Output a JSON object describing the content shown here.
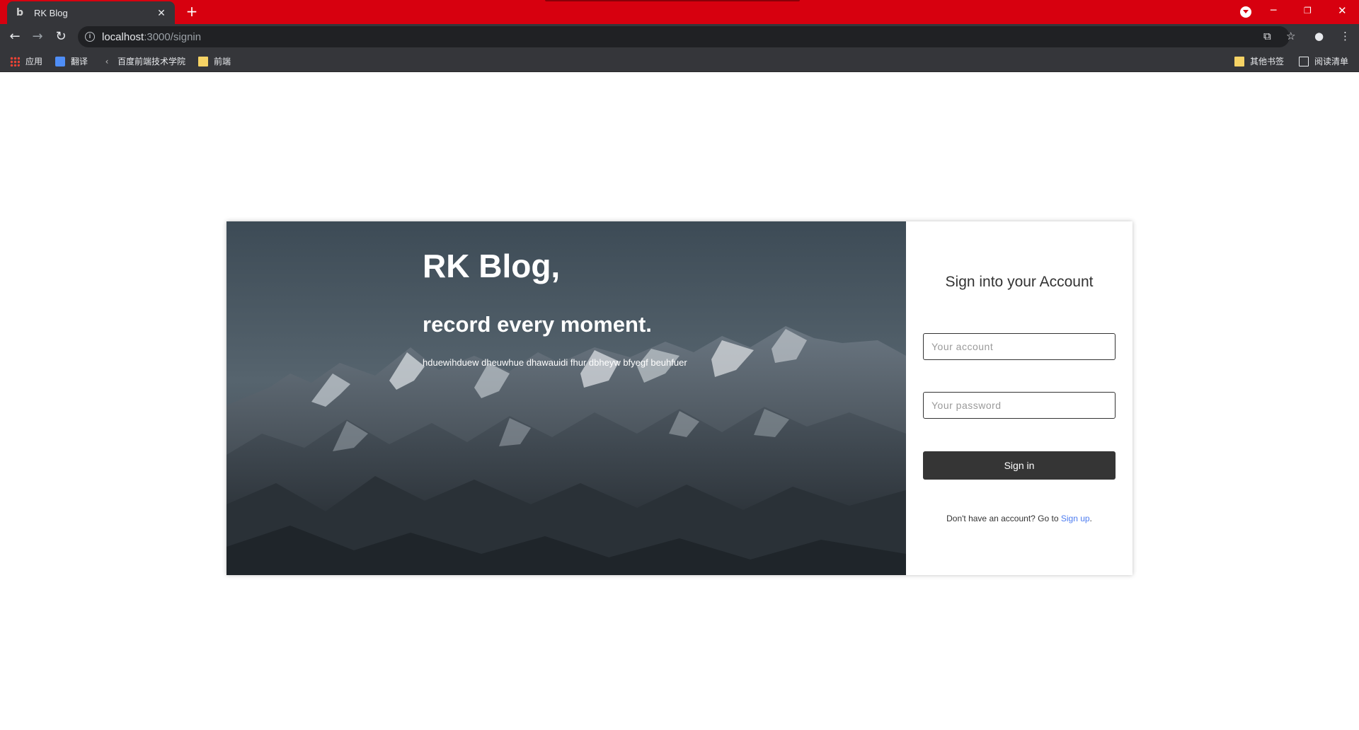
{
  "browser": {
    "tab_title": "RK Blog",
    "tab_favicon": "b",
    "url_host": "localhost",
    "url_path": ":3000/signin",
    "bookmarks": [
      {
        "label": "应用",
        "icon": "apps-icon"
      },
      {
        "label": "翻译",
        "icon": "translate-icon"
      },
      {
        "label": "百度前端技术学院",
        "icon": "baidu-icon"
      },
      {
        "label": "前端",
        "icon": "folder-icon"
      }
    ],
    "bookmarks_right": [
      {
        "label": "其他书签",
        "icon": "folder-icon"
      },
      {
        "label": "阅读清单",
        "icon": "reading-list-icon"
      }
    ],
    "colors": {
      "tabbar": "#d7000f",
      "chrome": "#35363a"
    }
  },
  "hero": {
    "title": "RK Blog,",
    "subtitle": "record every moment.",
    "description": "hduewihduew dheuwhue dhawauidi fhur dbheyw bfyegf beuhfuer"
  },
  "signin": {
    "heading": "Sign into your Account",
    "account_placeholder": "Your account",
    "password_placeholder": "Your password",
    "submit_label": "Sign in",
    "footer_prefix": "Don't have an account? Go to ",
    "footer_link": "Sign up",
    "footer_suffix": ".",
    "accent": "#4d7cf0",
    "button_color": "#353535"
  }
}
